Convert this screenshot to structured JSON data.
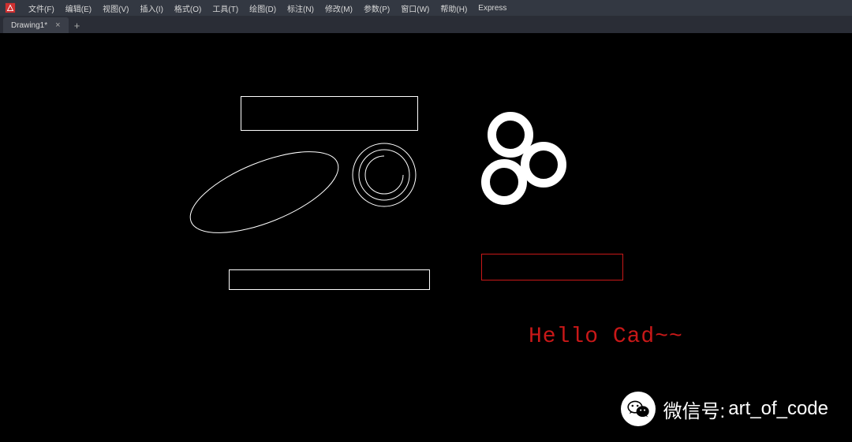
{
  "menu": {
    "items": [
      {
        "label": "文件(F)"
      },
      {
        "label": "编辑(E)"
      },
      {
        "label": "视图(V)"
      },
      {
        "label": "插入(I)"
      },
      {
        "label": "格式(O)"
      },
      {
        "label": "工具(T)"
      },
      {
        "label": "绘图(D)"
      },
      {
        "label": "标注(N)"
      },
      {
        "label": "修改(M)"
      },
      {
        "label": "参数(P)"
      },
      {
        "label": "窗口(W)"
      },
      {
        "label": "帮助(H)"
      },
      {
        "label": "Express"
      }
    ]
  },
  "tabs": {
    "active": "Drawing1*"
  },
  "canvas": {
    "hello_text": "Hello Cad~~",
    "shapes": {
      "rect_top": {
        "type": "rectangle",
        "stroke": "#ffffff"
      },
      "rect_bottom": {
        "type": "rectangle",
        "stroke": "#ffffff"
      },
      "ellipse": {
        "type": "ellipse",
        "stroke": "#ffffff",
        "rotation": -25
      },
      "concentric_circles": {
        "type": "three-concentric-circles",
        "stroke": "#ffffff"
      },
      "donuts": {
        "type": "three-donuts",
        "fill": "#ffffff"
      },
      "red_rect": {
        "type": "rectangle",
        "stroke": "#c81818"
      },
      "text": {
        "type": "text",
        "color": "#c81818",
        "value": "Hello Cad~~"
      }
    }
  },
  "watermark": {
    "label_prefix": "微信号:",
    "handle": "art_of_code"
  }
}
